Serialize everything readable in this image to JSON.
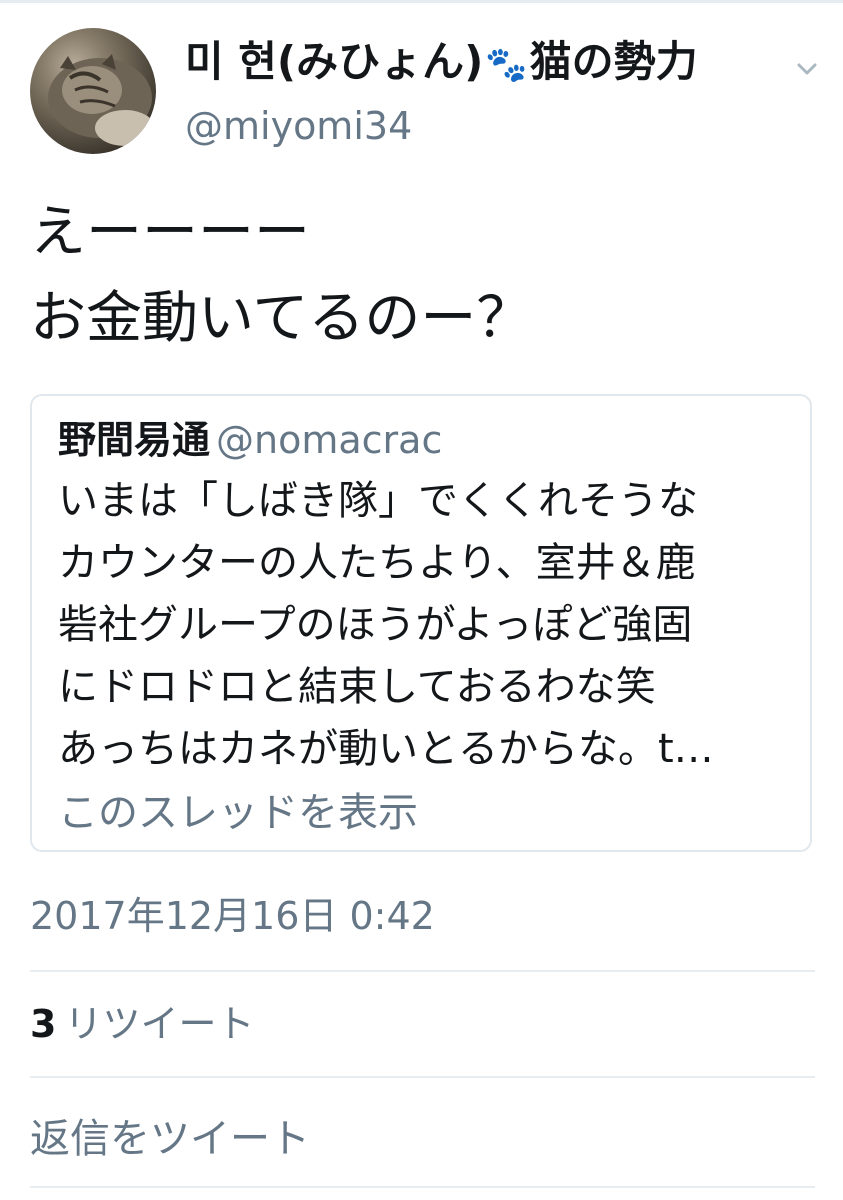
{
  "tweet": {
    "display_name": "미 현(みひょん)",
    "display_name_suffix": "猫の勢力",
    "paw_icon": "paw-prints-icon",
    "handle": "@miyomi34",
    "text_lines": [
      "えーーーー",
      "お金動いてるのー？"
    ],
    "timestamp": "2017年12月16日 0:42",
    "retweet_count": "3",
    "retweet_label": "リツイート",
    "reply_prompt": "返信をツイート"
  },
  "quote": {
    "name": "野間易通",
    "handle": "@nomacrac",
    "lines": [
      "いまは「しばき隊」でくくれそうな",
      "カウンターの人たちより、室井＆鹿",
      "砦社グループのほうがよっぽど強固",
      "にドロドロと結束しておるわな笑",
      "あっちはカネが動いとるからな。t…"
    ],
    "show_thread": "このスレッドを表示"
  },
  "colors": {
    "text": "#14171a",
    "secondary": "#657786",
    "border": "#e1e8ed",
    "divider": "#e6ecf0",
    "paw": "#7fb3c9"
  }
}
